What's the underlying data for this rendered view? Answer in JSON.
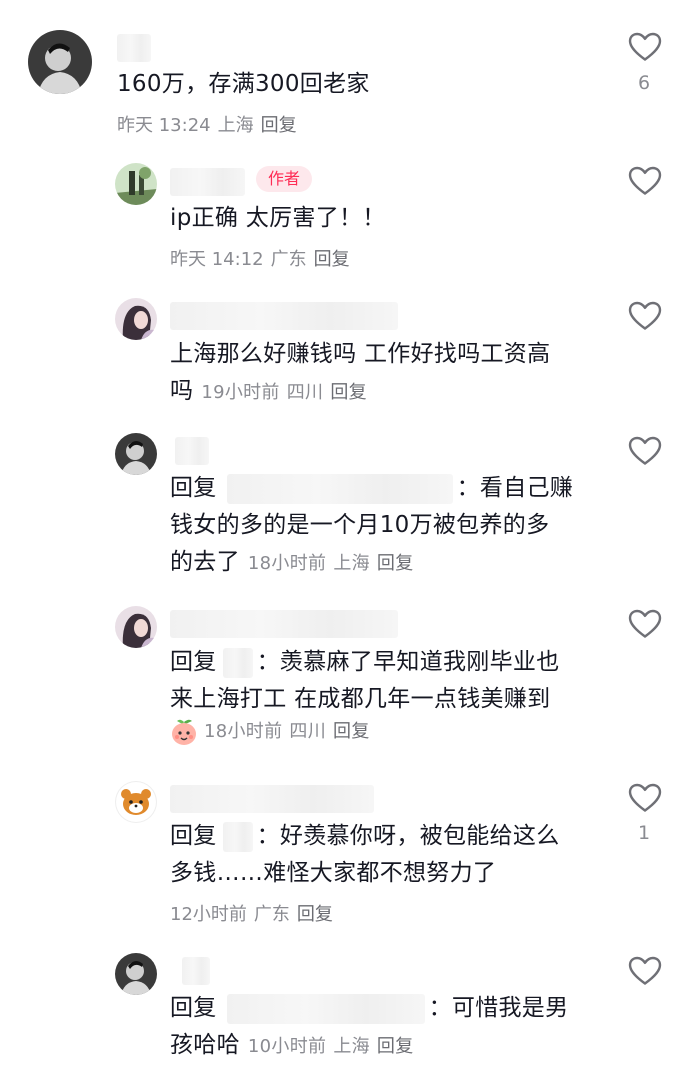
{
  "comments": [
    {
      "text": "160万，存满300回老家",
      "time": "昨天 13:24",
      "location": "上海",
      "reply_label": "回复",
      "likes": "6"
    },
    {
      "author_tag": "作者",
      "text": "ip正确 太厉害了！！",
      "time": "昨天 14:12",
      "location": "广东",
      "reply_label": "回复"
    },
    {
      "text_line1": "上海那么好赚钱吗 工作好找吗工资高",
      "text_line2": "吗",
      "time": "19小时前",
      "location": "四川",
      "reply_label": "回复"
    },
    {
      "reply_prefix": "回复",
      "line1_suffix": "：看自己赚",
      "line2": "钱女的多的是一个月10万被包养的多",
      "line3": "的去了",
      "time": "18小时前",
      "location": "上海",
      "reply_label": "回复"
    },
    {
      "reply_prefix": "回复",
      "line1_suffix": "：羡慕麻了早知道我刚毕业也",
      "line2": "来上海打工 在成都几年一点钱美赚到",
      "emoji": "peach-face-emoji",
      "time": "18小时前",
      "location": "四川",
      "reply_label": "回复"
    },
    {
      "reply_prefix": "回复",
      "line1_suffix": "：好羡慕你呀，被包能给这么",
      "line2": "多钱……难怪大家都不想努力了",
      "time": "12小时前",
      "location": "广东",
      "reply_label": "回复",
      "likes": "1"
    },
    {
      "reply_prefix": "回复",
      "line1_suffix": "：可惜我是男",
      "line2": "孩哈哈",
      "time": "10小时前",
      "location": "上海",
      "reply_label": "回复"
    }
  ],
  "colors": {
    "text": "#161823",
    "meta": "#8a8b91",
    "author_tag": "#fe2c55",
    "icon": "#6f7076"
  },
  "icons": {
    "like": "heart-outline-icon"
  }
}
